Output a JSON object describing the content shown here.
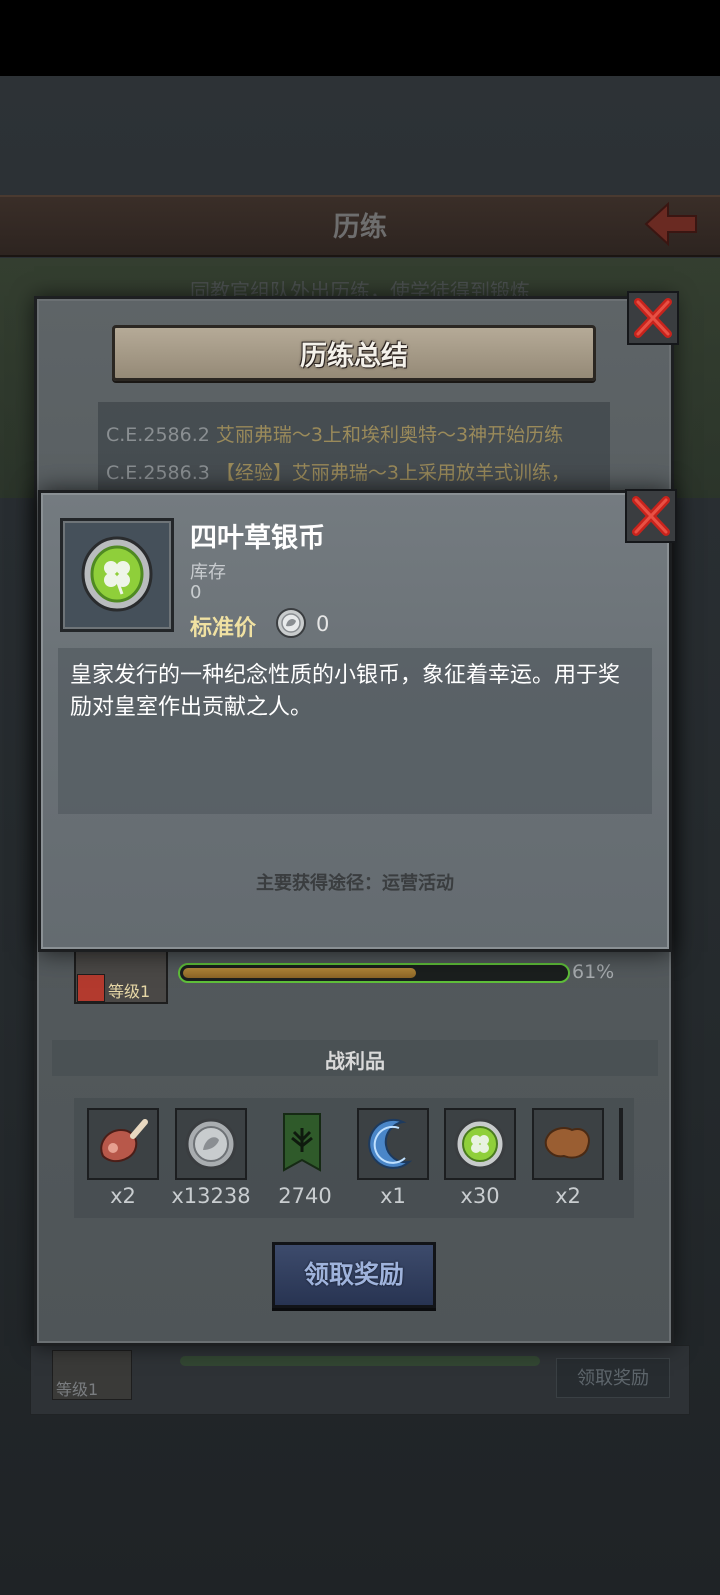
{
  "background": {
    "page_title": "历练",
    "subtitle": "同教官组队外出历练，使学徒得到锻炼",
    "bottom_row": {
      "level": "等级1",
      "claim_label": "领取奖励"
    }
  },
  "summary": {
    "title": "历练总结",
    "log": [
      {
        "date": "C.E.2586.2",
        "text": "艾丽弗瑞～3上和埃利奥特～3神开始历练"
      },
      {
        "date": "C.E.2586.3",
        "text": "【经验】艾丽弗瑞～3上采用放羊式训练，"
      }
    ],
    "progress": {
      "level": "等级1",
      "percent_value": 0.61,
      "percent_label": "61%"
    },
    "loot_title": "战利品",
    "loot": [
      {
        "icon": "ham-icon",
        "count": "x2"
      },
      {
        "icon": "silver-coin-icon",
        "count": "x13238"
      },
      {
        "icon": "tree-banner-icon",
        "count": "2740"
      },
      {
        "icon": "crescent-moon-icon",
        "count": "x1"
      },
      {
        "icon": "clover-coin-icon",
        "count": "x30"
      },
      {
        "icon": "leather-icon",
        "count": "x2"
      }
    ],
    "claim_label": "领取奖励"
  },
  "item": {
    "name": "四叶草银币",
    "stock_label": "库存",
    "stock_value": "0",
    "price_label": "标准价",
    "price_value": "0",
    "description": "皇家发行的一种纪念性质的小银币，象征着幸运。用于奖励对皇室作出贡献之人。",
    "source": "主要获得途径：运营活动"
  },
  "colors": {
    "progress_border": "#5fbf3a",
    "progress_fill": "#b58a3a",
    "close_red": "#c8231c",
    "price_gold": "#f0e1a2"
  }
}
